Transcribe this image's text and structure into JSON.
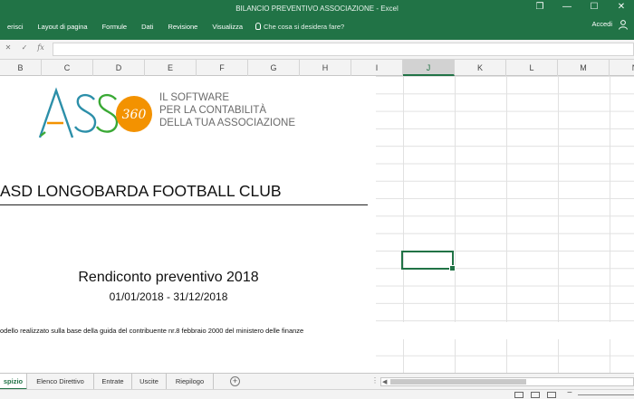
{
  "window": {
    "title": "BILANCIO PREVENTIVO ASSOCIAZIONE - Excel",
    "controls": {
      "restore": "❐",
      "minimize": "—",
      "maximize": "☐",
      "close": "✕"
    }
  },
  "ribbon": {
    "tabs": [
      {
        "label": "erisci"
      },
      {
        "label": "Layout di pagina"
      },
      {
        "label": "Formule"
      },
      {
        "label": "Dati"
      },
      {
        "label": "Revisione"
      },
      {
        "label": "Visualizza"
      }
    ],
    "tell_me": "Che cosa si desidera fare?",
    "accedi": "Accedi",
    "user_icon": "user-icon"
  },
  "formula_bar": {
    "cancel": "✕",
    "confirm": "✓",
    "fx": "fx",
    "value": ""
  },
  "columns": [
    {
      "label": "B"
    },
    {
      "label": "C"
    },
    {
      "label": "D"
    },
    {
      "label": "E"
    },
    {
      "label": "F"
    },
    {
      "label": "G"
    },
    {
      "label": "H"
    },
    {
      "label": "I"
    },
    {
      "label": "J"
    },
    {
      "label": "K"
    },
    {
      "label": "L"
    },
    {
      "label": "M"
    },
    {
      "label": "N"
    }
  ],
  "selected_column": "J",
  "logo": {
    "letters": "ASS",
    "badge": "360",
    "tagline": [
      "IL SOFTWARE",
      "PER LA CONTABILITÀ",
      "DELLA TUA ASSOCIAZIONE"
    ],
    "colors": {
      "orange": "#f39200",
      "green": "#3aa935",
      "teal": "#2c8fa9",
      "grey": "#6b6b6b"
    }
  },
  "sheet": {
    "club_name": "ASD LONGOBARDA FOOTBALL CLUB",
    "title": "Rendiconto preventivo 2018",
    "period": "01/01/2018 - 31/12/2018",
    "note": "odello realizzato sulla base della guida del contribuente nr.8 febbraio 2000 del ministero delle finanze"
  },
  "sheet_tabs": [
    {
      "label": "spizio",
      "active": true
    },
    {
      "label": "Elenco Direttivo",
      "active": false
    },
    {
      "label": "Entrate",
      "active": false
    },
    {
      "label": "Uscite",
      "active": false
    },
    {
      "label": "Riepilogo",
      "active": false
    }
  ],
  "sheet_tab_controls": {
    "add": "+",
    "more": "⋮",
    "scroll_left": "◀"
  },
  "status_bar": {
    "zoom_out": "−"
  },
  "accent_color": "#217346"
}
